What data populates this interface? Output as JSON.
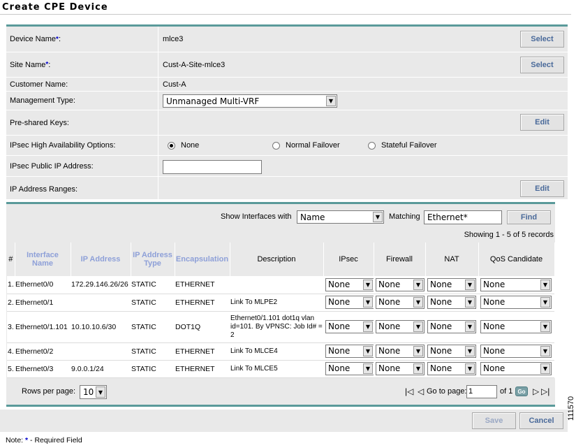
{
  "page": {
    "title": "Create CPE Device"
  },
  "form": {
    "device_name": {
      "label": "Device Name",
      "required_mark": "*",
      "suffix": ":",
      "value": "mlce3",
      "button": "Select"
    },
    "site_name": {
      "label": "Site Name",
      "required_mark": "*",
      "suffix": ":",
      "value": "Cust-A-Site-mlce3",
      "button": "Select"
    },
    "customer_name": {
      "label": "Customer Name:",
      "value": "Cust-A"
    },
    "management_type": {
      "label": "Management Type:",
      "value": "Unmanaged Multi-VRF"
    },
    "preshared_keys": {
      "label": "Pre-shared Keys:",
      "button": "Edit"
    },
    "ipsec_ha": {
      "label": "IPsec High Availability Options:",
      "options": [
        "None",
        "Normal Failover",
        "Stateful Failover"
      ],
      "selected": "None"
    },
    "ipsec_public_ip": {
      "label": "IPsec Public IP Address:",
      "value": ""
    },
    "ip_ranges": {
      "label": "IP Address Ranges:",
      "button": "Edit"
    }
  },
  "filter": {
    "show_label": "Show Interfaces with",
    "field_value": "Name",
    "matching_label": "Matching",
    "matching_value": "Ethernet*",
    "find_button": "Find"
  },
  "showing_text": "Showing 1 - 5 of 5 records",
  "table": {
    "headers": {
      "num": "#",
      "interface": "Interface Name",
      "ip": "IP Address",
      "type": "IP Address Type",
      "encap": "Encapsulation",
      "desc": "Description",
      "ipsec": "IPsec",
      "firewall": "Firewall",
      "nat": "NAT",
      "qos": "QoS Candidate"
    },
    "rows": [
      {
        "num": "1.",
        "interface": "Ethernet0/0",
        "ip": "172.29.146.26/26",
        "type": "STATIC",
        "encap": "ETHERNET",
        "desc": "",
        "ipsec": "None",
        "firewall": "None",
        "nat": "None",
        "qos": "None"
      },
      {
        "num": "2.",
        "interface": "Ethernet0/1",
        "ip": "",
        "type": "STATIC",
        "encap": "ETHERNET",
        "desc": "Link To MLPE2",
        "ipsec": "None",
        "firewall": "None",
        "nat": "None",
        "qos": "None"
      },
      {
        "num": "3.",
        "interface": "Ethernet0/1.101",
        "ip": "10.10.10.6/30",
        "type": "STATIC",
        "encap": "DOT1Q",
        "desc": "Ethernet0/1.101 dot1q vlan id=101. By VPNSC: Job Id# = 2",
        "ipsec": "None",
        "firewall": "None",
        "nat": "None",
        "qos": "None"
      },
      {
        "num": "4.",
        "interface": "Ethernet0/2",
        "ip": "",
        "type": "STATIC",
        "encap": "ETHERNET",
        "desc": "Link To MLCE4",
        "ipsec": "None",
        "firewall": "None",
        "nat": "None",
        "qos": "None"
      },
      {
        "num": "5.",
        "interface": "Ethernet0/3",
        "ip": "9.0.0.1/24",
        "type": "STATIC",
        "encap": "ETHERNET",
        "desc": "Link To MLCE5",
        "ipsec": "None",
        "firewall": "None",
        "nat": "None",
        "qos": "None"
      }
    ]
  },
  "pager": {
    "rows_label": "Rows per page:",
    "rows_value": "10",
    "goto_label": "Go to page:",
    "page_value": "1",
    "of_label": "of 1",
    "go_button": "Go"
  },
  "actions": {
    "save": "Save",
    "cancel": "Cancel"
  },
  "note": {
    "prefix": "Note: ",
    "star": "*",
    "text": " - Required Field"
  },
  "figure_id": "111570",
  "icons": {
    "first": "first-page-icon",
    "prev": "prev-page-icon",
    "next": "next-page-icon",
    "last": "last-page-icon",
    "dropdown": "dropdown-arrow-icon"
  }
}
